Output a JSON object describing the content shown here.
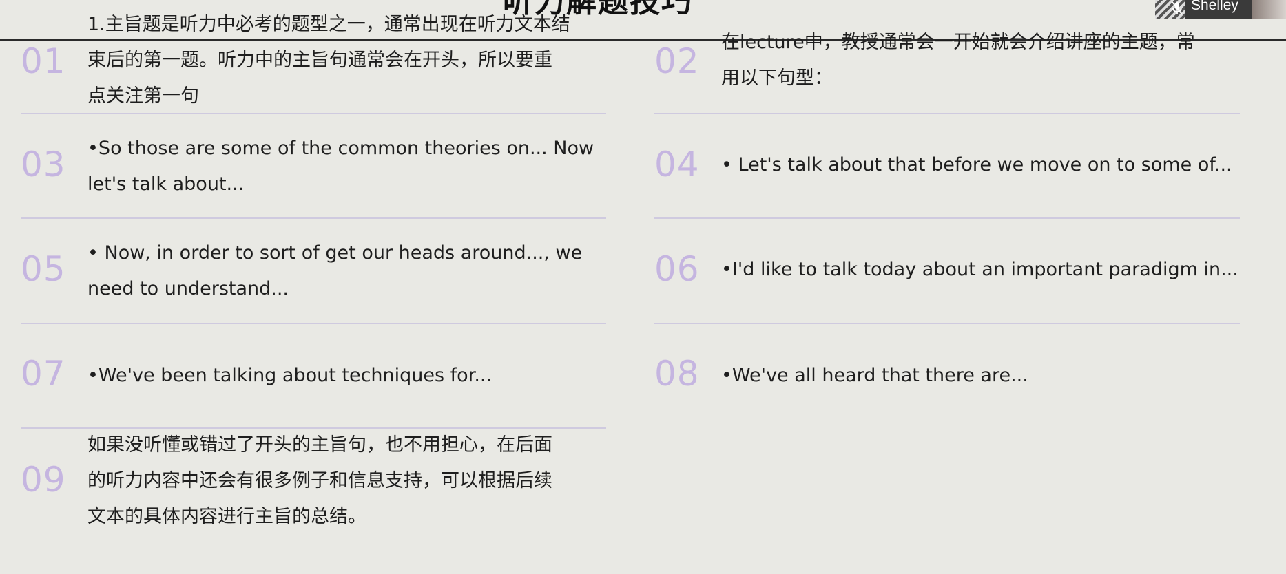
{
  "slide": {
    "title": "听力解题技巧"
  },
  "items": [
    {
      "num": "01",
      "text": "1.主旨题是听力中必考的题型之一，通常出现在听力文本结\n束后的第一题。听力中的主旨句通常会在开头，所以要重\n点关注第一句"
    },
    {
      "num": "02",
      "text": "在lecture中，教授通常会一开始就会介绍讲座的主题，常\n用以下句型："
    },
    {
      "num": "03",
      "text": "•So those are some of the common theories on... Now\nlet's talk about..."
    },
    {
      "num": "04",
      "text": "• Let's talk about that before we move on to some of..."
    },
    {
      "num": "05",
      "text": "• Now, in order to sort of get our heads around..., we\nneed to understand..."
    },
    {
      "num": "06",
      "text": "•I'd like to talk today about an important paradigm in..."
    },
    {
      "num": "07",
      "text": "•We've been talking about techniques for..."
    },
    {
      "num": "08",
      "text": "•We've all heard that there are..."
    },
    {
      "num": "09",
      "text": "如果没听懂或错过了开头的主旨句，也不用担心，在后面\n的听力内容中还会有很多例子和信息支持，可以根据后续\n文本的具体内容进行主旨的总结。"
    }
  ],
  "video_overlay": {
    "speaker_name": "Shelley",
    "mic_icon": "mic-muted-icon"
  },
  "colors": {
    "background": "#e9e9e4",
    "number_accent": "#c5b5e0",
    "divider": "#cfcadf",
    "text": "#1e1e1e"
  }
}
